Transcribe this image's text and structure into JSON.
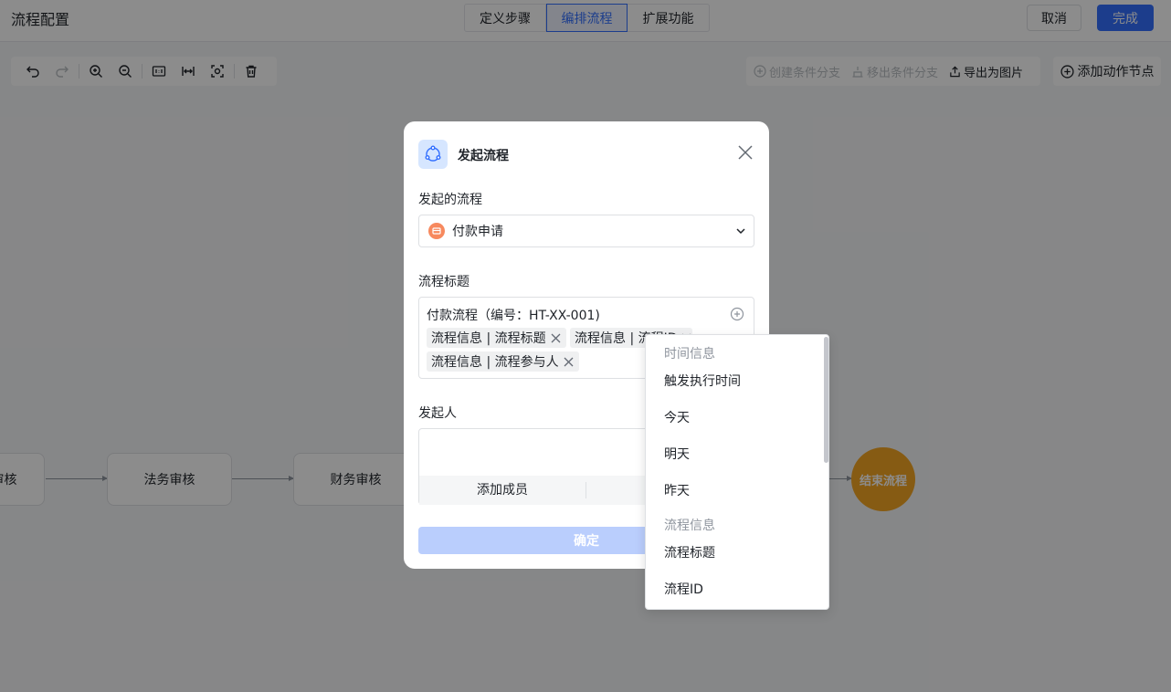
{
  "header": {
    "title": "流程配置",
    "tabs": [
      "定义步骤",
      "编排流程",
      "扩展功能"
    ],
    "cancel_label": "取消",
    "done_label": "完成"
  },
  "right_tools": {
    "create_branch": "创建条件分支",
    "remove_branch": "移出条件分支",
    "export_image": "导出为图片",
    "add_action": "添加动作节点"
  },
  "flow": {
    "nodes": [
      "审核",
      "法务审核",
      "财务审核"
    ],
    "end_label": "结束流程"
  },
  "modal": {
    "title": "发起流程",
    "flow_label": "发起的流程",
    "flow_value": "付款申请",
    "title_label": "流程标题",
    "title_text": "付款流程（编号：HT-XX-001)",
    "tags": [
      "流程信息 | 流程标题",
      "流程信息 | 流程ID",
      "流程信息 | 流程参与人"
    ],
    "initiator_label": "发起人",
    "add_member": "添加成员",
    "confirm": "确定"
  },
  "dropdown": {
    "groups": [
      {
        "label": "时间信息",
        "items": [
          "触发执行时间",
          "今天",
          "明天",
          "昨天"
        ]
      },
      {
        "label": "流程信息",
        "items": [
          "流程标题",
          "流程ID"
        ]
      }
    ]
  },
  "colors": {
    "accent": "#3370ff",
    "end_node": "#f5a623",
    "confirm_disabled": "#bacefd"
  }
}
